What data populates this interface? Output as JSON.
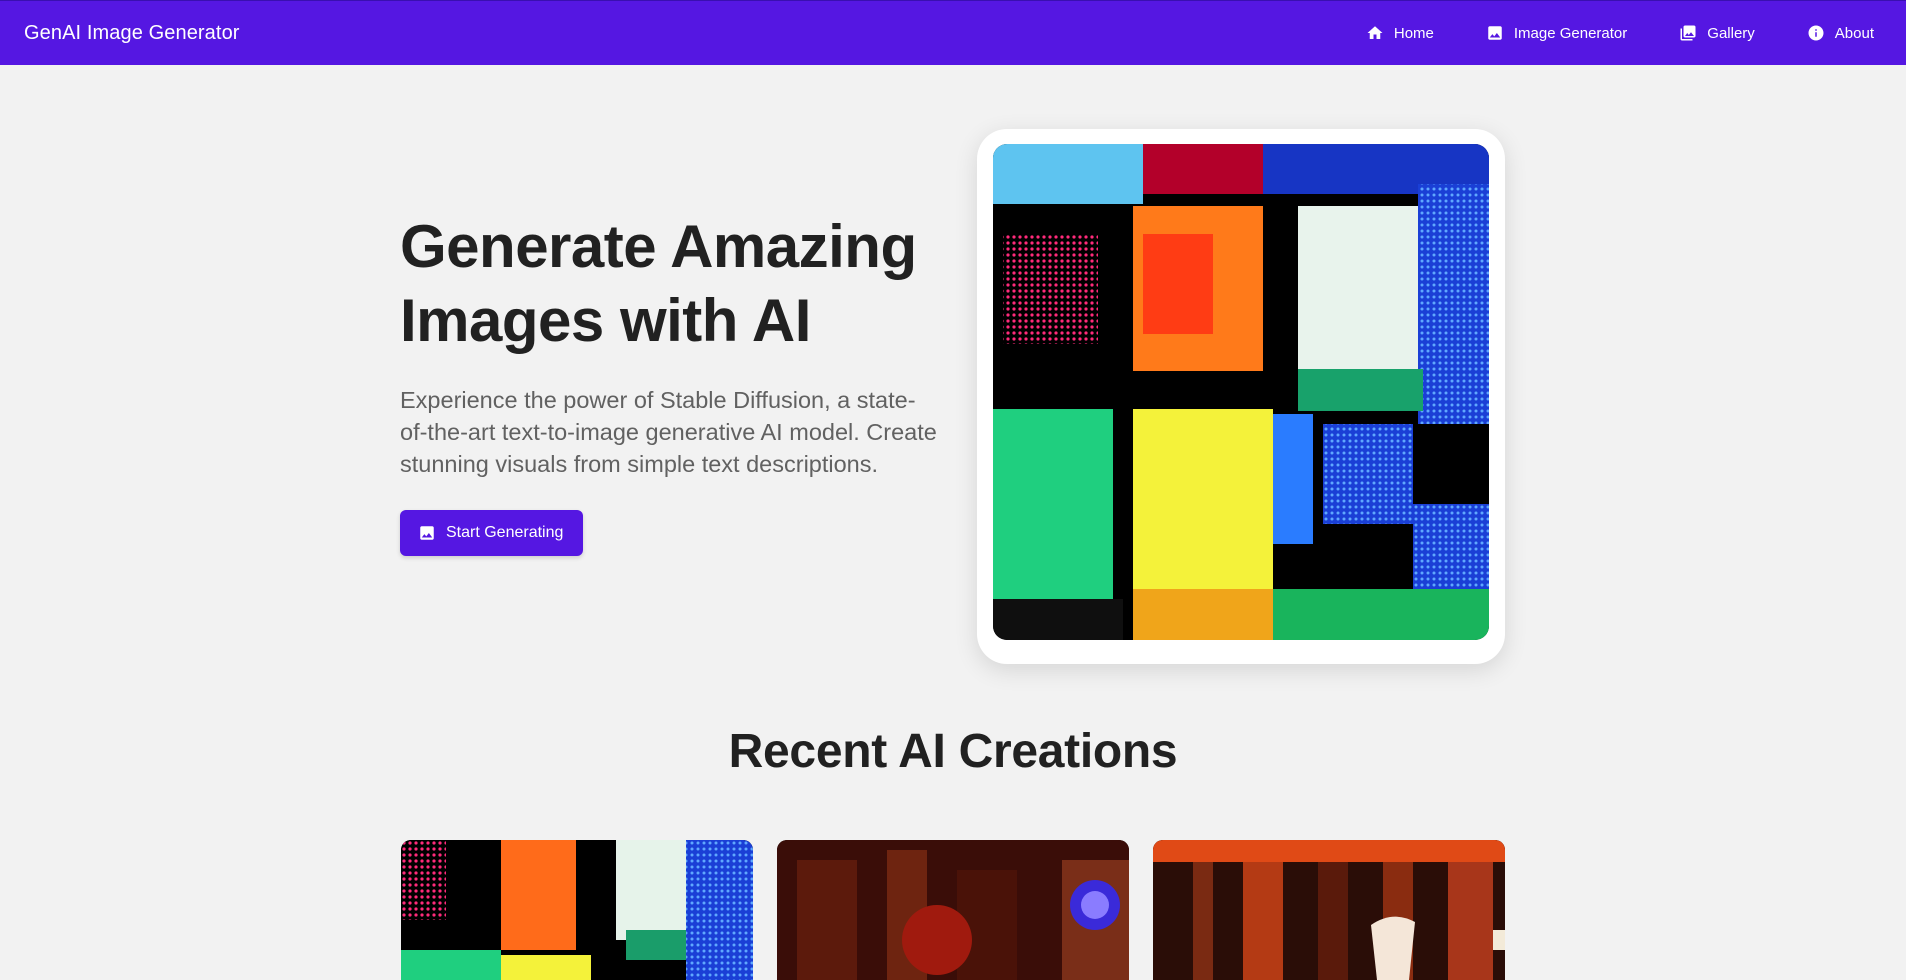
{
  "app": {
    "brand": "GenAI Image Generator"
  },
  "nav": {
    "items": [
      {
        "label": "Home",
        "icon": "home-icon"
      },
      {
        "label": "Image Generator",
        "icon": "image-icon"
      },
      {
        "label": "Gallery",
        "icon": "gallery-icon"
      },
      {
        "label": "About",
        "icon": "info-icon"
      }
    ]
  },
  "hero": {
    "title": "Generate Amazing Images with AI",
    "description": "Experience the power of Stable Diffusion, a state-of-the-art text-to-image generative AI model. Create stunning visuals from simple text descriptions.",
    "cta_label": "Start Generating",
    "cta_icon": "image-icon"
  },
  "recent": {
    "title": "Recent AI Creations"
  },
  "colors": {
    "primary": "#5517e2",
    "background": "#f2f2f2",
    "heading": "#212121",
    "body_text": "#616161"
  }
}
